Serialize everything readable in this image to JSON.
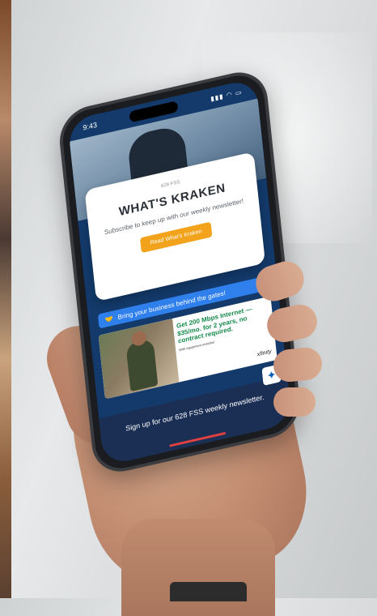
{
  "status_bar": {
    "time": "9:43",
    "icons": "▮▮▮ ◠ ▭"
  },
  "modal": {
    "kicker": "628 FSS",
    "title": "WHAT'S KRAKEN",
    "subtitle": "Subscribe to keep up with our weekly newsletter!",
    "button_label": "Read What's Kraken"
  },
  "promo": {
    "label": "Bring your business behind the gates!"
  },
  "ad": {
    "headline": "Get 200 Mbps Internet — $35/mo. for 2 years, no contract required.",
    "fine_print": "With equipment included",
    "brand": "xfinity"
  },
  "signup": {
    "text": "Sign up for our 628 FSS weekly newsletter."
  },
  "colors": {
    "header_blue": "#133a6b",
    "button_orange": "#f2a21b",
    "promo_blue": "#2f80ed",
    "ad_green": "#13894a"
  }
}
